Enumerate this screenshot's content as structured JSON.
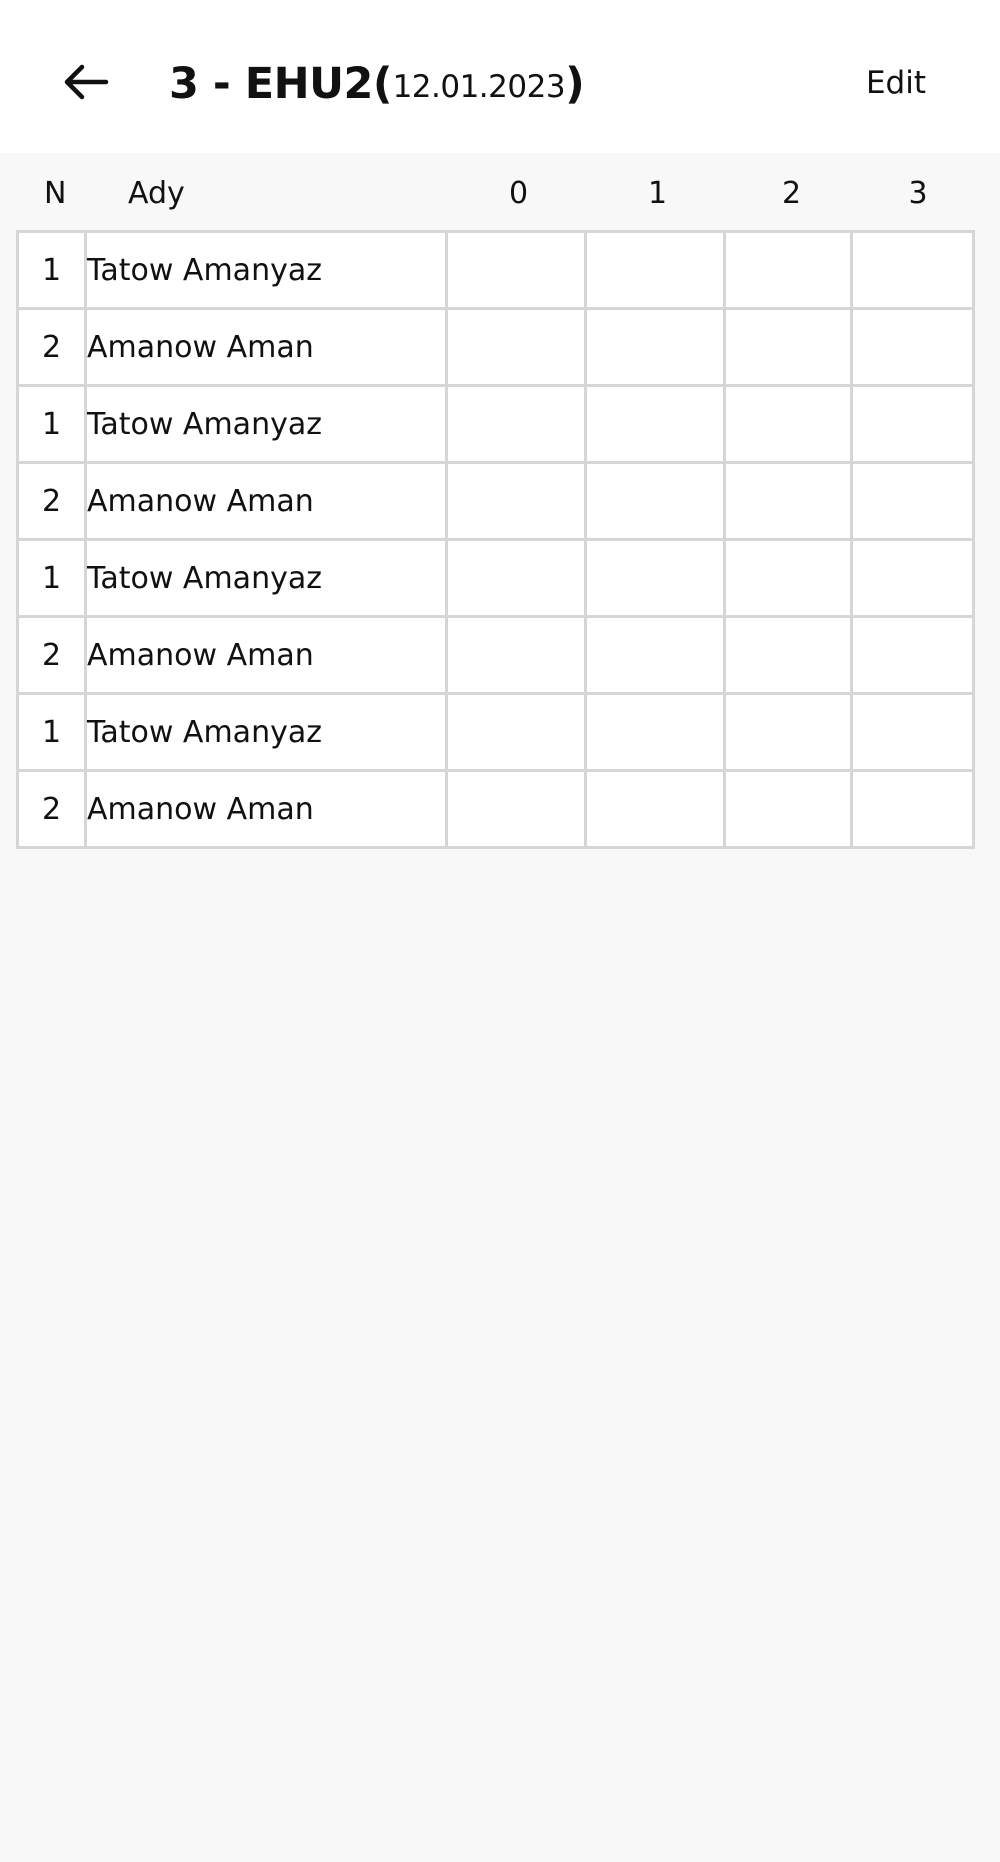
{
  "appbar": {
    "back_icon": "arrow-left-icon",
    "title_main": "3 - EHU2",
    "title_open_paren": "(",
    "title_date": "12.01.2023",
    "title_close_paren": ")",
    "edit_label": "Edit"
  },
  "table": {
    "headers": {
      "n": "N",
      "name": "Ady",
      "col0": "0",
      "col1": "1",
      "col2": "2",
      "col3": "3"
    },
    "rows": [
      {
        "n": "1",
        "name": "Tatow Amanyaz",
        "c0": "",
        "c1": "",
        "c2": "",
        "c3": ""
      },
      {
        "n": "2",
        "name": "Amanow Aman",
        "c0": "",
        "c1": "",
        "c2": "",
        "c3": ""
      },
      {
        "n": "1",
        "name": "Tatow Amanyaz",
        "c0": "",
        "c1": "",
        "c2": "",
        "c3": ""
      },
      {
        "n": "2",
        "name": "Amanow Aman",
        "c0": "",
        "c1": "",
        "c2": "",
        "c3": ""
      },
      {
        "n": "1",
        "name": "Tatow Amanyaz",
        "c0": "",
        "c1": "",
        "c2": "",
        "c3": ""
      },
      {
        "n": "2",
        "name": "Amanow Aman",
        "c0": "",
        "c1": "",
        "c2": "",
        "c3": ""
      },
      {
        "n": "1",
        "name": "Tatow Amanyaz",
        "c0": "",
        "c1": "",
        "c2": "",
        "c3": ""
      },
      {
        "n": "2",
        "name": "Amanow Aman",
        "c0": "",
        "c1": "",
        "c2": "",
        "c3": ""
      }
    ]
  },
  "colors": {
    "appbar_background": "#ffffff",
    "page_background": "#f8f8f8",
    "grid_line": "#d6d6d6",
    "text": "#111111"
  }
}
